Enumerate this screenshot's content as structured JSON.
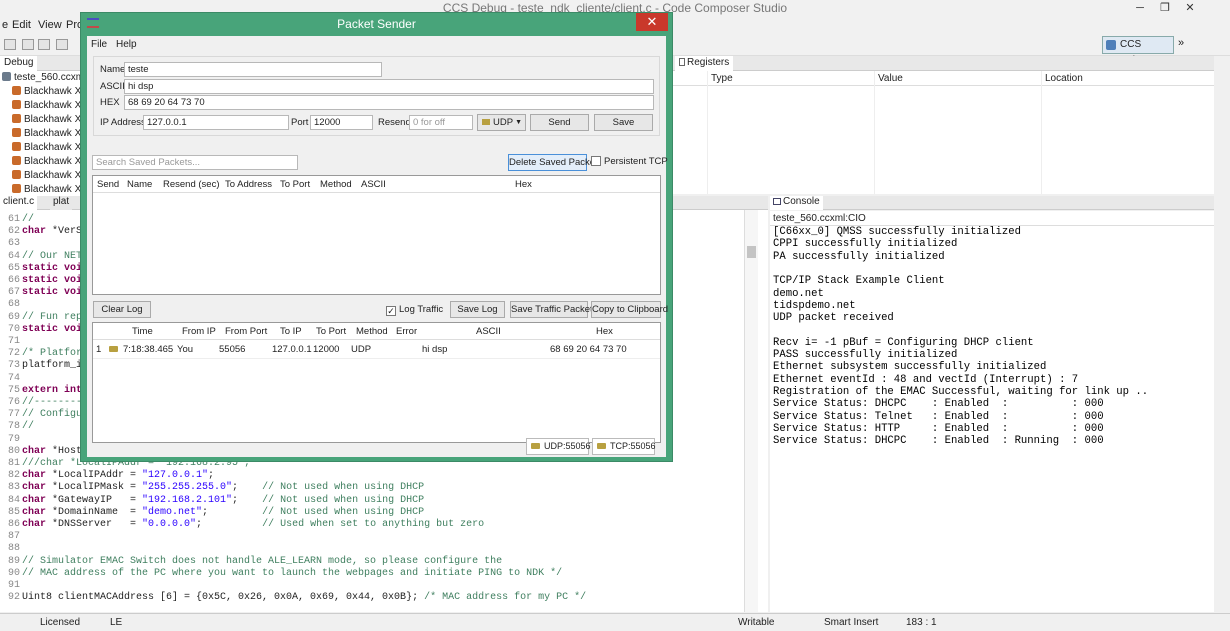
{
  "ccs": {
    "title": "CCS Debug - teste_ndk_cliente/client.c - Code Composer Studio",
    "menu": [
      "e",
      "Edit",
      "View",
      "Pro"
    ],
    "perspective": "CCS Debug",
    "debug_tab": "Debug",
    "debug_tree_root": "teste_560.ccxm",
    "debug_tree_items": [
      "Blackhawk X",
      "Blackhawk X",
      "Blackhawk X",
      "Blackhawk X",
      "Blackhawk X",
      "Blackhawk X",
      "Blackhawk X",
      "Blackhawk X"
    ],
    "registers_tab": "Registers",
    "registers_columns": [
      "Type",
      "Value",
      "Location"
    ],
    "editor_tabs": [
      "client.c",
      "plat"
    ],
    "code_lines": [
      {
        "n": "61",
        "segs": [
          {
            "c": "cm",
            "t": "//"
          }
        ]
      },
      {
        "n": "62",
        "segs": [
          {
            "c": "kw",
            "t": "char"
          },
          {
            "c": "",
            "t": " *VerS"
          }
        ]
      },
      {
        "n": "63",
        "segs": []
      },
      {
        "n": "64",
        "segs": [
          {
            "c": "cm",
            "t": "// Our NET"
          }
        ]
      },
      {
        "n": "65",
        "segs": [
          {
            "c": "kw",
            "t": "static voi"
          }
        ]
      },
      {
        "n": "66",
        "segs": [
          {
            "c": "kw",
            "t": "static voi"
          }
        ]
      },
      {
        "n": "67",
        "segs": [
          {
            "c": "kw",
            "t": "static voi"
          }
        ]
      },
      {
        "n": "68",
        "segs": []
      },
      {
        "n": "69",
        "segs": [
          {
            "c": "cm",
            "t": "// Fun rep"
          }
        ]
      },
      {
        "n": "70",
        "segs": [
          {
            "c": "kw",
            "t": "static voi"
          }
        ]
      },
      {
        "n": "71",
        "segs": []
      },
      {
        "n": "72",
        "segs": [
          {
            "c": "cm",
            "t": "/* Platfor"
          }
        ]
      },
      {
        "n": "73",
        "segs": [
          {
            "c": "",
            "t": "platform_i"
          }
        ]
      },
      {
        "n": "74",
        "segs": []
      },
      {
        "n": "75",
        "segs": [
          {
            "c": "kw",
            "t": "extern int"
          }
        ]
      },
      {
        "n": "76",
        "segs": [
          {
            "c": "cm",
            "t": "//--------"
          }
        ]
      },
      {
        "n": "77",
        "segs": [
          {
            "c": "cm",
            "t": "// Configu"
          }
        ]
      },
      {
        "n": "78",
        "segs": [
          {
            "c": "cm",
            "t": "//"
          }
        ]
      },
      {
        "n": "79",
        "segs": []
      },
      {
        "n": "80",
        "segs": [
          {
            "c": "kw",
            "t": "char"
          },
          {
            "c": "",
            "t": " *HostN"
          }
        ]
      },
      {
        "n": "81",
        "segs": [
          {
            "c": "cm",
            "t": "///char *LocalIPAddr = \"192.168.2.95\";"
          }
        ]
      },
      {
        "n": "82",
        "segs": [
          {
            "c": "kw",
            "t": "char"
          },
          {
            "c": "",
            "t": " *LocalIPAddr = "
          },
          {
            "c": "str",
            "t": "\"127.0.0.1\""
          },
          {
            "c": "",
            "t": ";"
          }
        ]
      },
      {
        "n": "83",
        "segs": [
          {
            "c": "kw",
            "t": "char"
          },
          {
            "c": "",
            "t": " *LocalIPMask = "
          },
          {
            "c": "str",
            "t": "\"255.255.255.0\""
          },
          {
            "c": "",
            "t": ";    "
          },
          {
            "c": "cm",
            "t": "// Not used when using DHCP"
          }
        ]
      },
      {
        "n": "84",
        "segs": [
          {
            "c": "kw",
            "t": "char"
          },
          {
            "c": "",
            "t": " *GatewayIP   = "
          },
          {
            "c": "str",
            "t": "\"192.168.2.101\""
          },
          {
            "c": "",
            "t": ";    "
          },
          {
            "c": "cm",
            "t": "// Not used when using DHCP"
          }
        ]
      },
      {
        "n": "85",
        "segs": [
          {
            "c": "kw",
            "t": "char"
          },
          {
            "c": "",
            "t": " *DomainName  = "
          },
          {
            "c": "str",
            "t": "\"demo.net\""
          },
          {
            "c": "",
            "t": ";         "
          },
          {
            "c": "cm",
            "t": "// Not used when using DHCP"
          }
        ]
      },
      {
        "n": "86",
        "segs": [
          {
            "c": "kw",
            "t": "char"
          },
          {
            "c": "",
            "t": " *DNSServer   = "
          },
          {
            "c": "str",
            "t": "\"0.0.0.0\""
          },
          {
            "c": "",
            "t": ";          "
          },
          {
            "c": "cm",
            "t": "// Used when set to anything but zero"
          }
        ]
      },
      {
        "n": "87",
        "segs": []
      },
      {
        "n": "88",
        "segs": []
      },
      {
        "n": "89",
        "segs": [
          {
            "c": "cm",
            "t": "// Simulator EMAC Switch does not handle ALE_LEARN mode, so please configure the"
          }
        ]
      },
      {
        "n": "90",
        "segs": [
          {
            "c": "cm",
            "t": "// MAC address of the PC where you want to launch the webpages and initiate PING to NDK */"
          }
        ]
      },
      {
        "n": "91",
        "segs": []
      },
      {
        "n": "92",
        "segs": [
          {
            "c": "",
            "t": "Uint8 clientMACAddress [6] = {0x5C, 0x26, 0x0A, 0x69, 0x44, 0x0B}; "
          },
          {
            "c": "cm",
            "t": "/* MAC address for my PC */"
          }
        ]
      }
    ],
    "console_tab": "Console",
    "console_source": "teste_560.ccxml:CIO",
    "console_lines": [
      "[C66xx_0] QMSS successfully initialized",
      "CPPI successfully initialized",
      "PA successfully initialized",
      "",
      "TCP/IP Stack Example Client",
      "demo.net",
      "tidspdemo.net",
      "UDP packet received",
      "",
      "Recv i= -1 pBuf = Configuring DHCP client",
      "PASS successfully initialized",
      "Ethernet subsystem successfully initialized",
      "Ethernet eventId : 48 and vectId (Interrupt) : 7",
      "Registration of the EMAC Successful, waiting for link up ..",
      "Service Status: DHCPC    : Enabled  :          : 000",
      "Service Status: Telnet   : Enabled  :          : 000",
      "Service Status: HTTP     : Enabled  :          : 000",
      "Service Status: DHCPC    : Enabled  : Running  : 000"
    ],
    "status": {
      "licensed": "Licensed",
      "encoding": "LE",
      "writable": "Writable",
      "insert": "Smart Insert",
      "position": "183 : 1"
    }
  },
  "ps": {
    "title": "Packet Sender",
    "menu": [
      "File",
      "Help"
    ],
    "name_label": "Name",
    "name_value": "teste",
    "ascii_label": "ASCII",
    "ascii_value": "hi dsp",
    "hex_label": "HEX",
    "hex_value": "68 69 20 64 73 70",
    "ip_label": "IP Address",
    "ip_value": "127.0.0.1",
    "port_label": "Port",
    "port_value": "12000",
    "resend_label": "Resend",
    "resend_placeholder": "0 for off",
    "protocol": "UDP",
    "send_label": "Send",
    "save_label": "Save",
    "search_placeholder": "Search Saved Packets...",
    "delete_saved_label": "Delete Saved Packet",
    "persistent_tcp_label": "Persistent TCP",
    "saved_columns": [
      "Send",
      "Name",
      "Resend (sec)",
      "To Address",
      "To Port",
      "Method",
      "ASCII",
      "Hex"
    ],
    "clear_log_label": "Clear Log",
    "log_traffic_label": "Log Traffic",
    "save_log_label": "Save Log",
    "save_traffic_label": "Save Traffic Packet",
    "copy_clipboard_label": "Copy to Clipboard",
    "log_columns": [
      "Time",
      "From IP",
      "From Port",
      "To IP",
      "To Port",
      "Method",
      "Error",
      "ASCII",
      "Hex"
    ],
    "log_rows": [
      {
        "idx": "1",
        "time": "7:18:38.465",
        "from_ip": "You",
        "from_port": "55056",
        "to_ip": "127.0.0.1",
        "to_port": "12000",
        "method": "UDP",
        "error": "",
        "ascii": "hi dsp",
        "hex": "68 69 20 64 73 70"
      }
    ],
    "udp_status": "UDP:55056",
    "tcp_status": "TCP:55056"
  }
}
